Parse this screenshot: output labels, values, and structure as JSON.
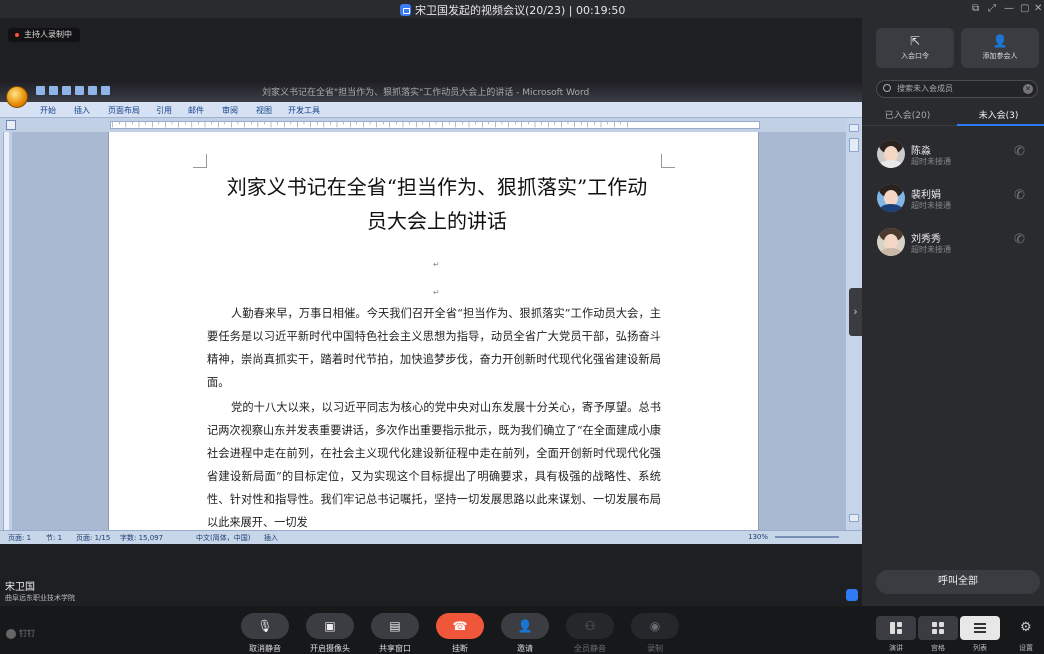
{
  "window": {
    "title": "宋卫国发起的视频会议(20/23) | 00:19:50"
  },
  "recording_badge": "主持人录制中",
  "shared_doc": {
    "title_bar": "刘家义书记在全省\"担当作为、狠抓落实\"工作动员大会上的讲话 - Microsoft Word",
    "ribbon_tabs": [
      "开始",
      "插入",
      "页面布局",
      "引用",
      "邮件",
      "审阅",
      "视图",
      "开发工具"
    ],
    "heading_line1": "刘家义书记在全省“担当作为、狠抓落实”工作动",
    "heading_line2": "员大会上的讲话",
    "paragraph1": "人勤春来早，万事日相催。今天我们召开全省“担当作为、狠抓落实”工作动员大会，主要任务是以习近平新时代中国特色社会主义思想为指导，动员全省广大党员干部，弘扬奋斗精神，崇尚真抓实干，踏着时代节拍，加快追梦步伐，奋力开创新时代现代化强省建设新局面。",
    "paragraph2": "党的十八大以来，以习近平同志为核心的党中央对山东发展十分关心，寄予厚望。总书记两次视察山东并发表重要讲话，多次作出重要指示批示，既为我们确立了“在全面建成小康社会进程中走在前列，在社会主义现代化建设新征程中走在前列，全面开创新时代现代化强省建设新局面”的目标定位，又为实现这个目标提出了明确要求，具有极强的战略性、系统性、针对性和指导性。我们牢记总书记嘱托，坚持一切发展思路以此来谋划、一切发展布局以此来展开、一切发",
    "status": {
      "page": "页面: 1",
      "section": "节: 1",
      "page_of": "页面: 1/15",
      "words": "字数: 15,097",
      "language": "中文(简体，中国)",
      "mode": "插入",
      "zoom": "130%"
    }
  },
  "host": {
    "name": "宋卫国",
    "org": "曲阜远东职业技术学院"
  },
  "logo": "钉钉",
  "toolbar": {
    "buttons": [
      {
        "label": "取消静音",
        "icon": "mic-muted-icon"
      },
      {
        "label": "开启摄像头",
        "icon": "camera-off-icon"
      },
      {
        "label": "共享窗口",
        "icon": "share-screen-icon"
      },
      {
        "label": "挂断",
        "icon": "hangup-icon"
      },
      {
        "label": "邀请",
        "icon": "invite-icon"
      },
      {
        "label": "全员静音",
        "icon": "mute-all-icon"
      },
      {
        "label": "录制",
        "icon": "record-icon"
      }
    ]
  },
  "sidebar": {
    "join_code_label": "入会口令",
    "add_member_label": "添加参会人",
    "search_placeholder": "搜索未入会成员",
    "tab_joined": "已入会(20)",
    "tab_not_joined": "未入会(3)",
    "members": [
      {
        "name": "陈淼",
        "status": "超时未接通"
      },
      {
        "name": "裴利娟",
        "status": "超时未接通"
      },
      {
        "name": "刘秀秀",
        "status": "超时未接通"
      }
    ],
    "call_all": "呼叫全部",
    "views": [
      "演讲",
      "宫格",
      "列表"
    ],
    "settings": "设置"
  }
}
